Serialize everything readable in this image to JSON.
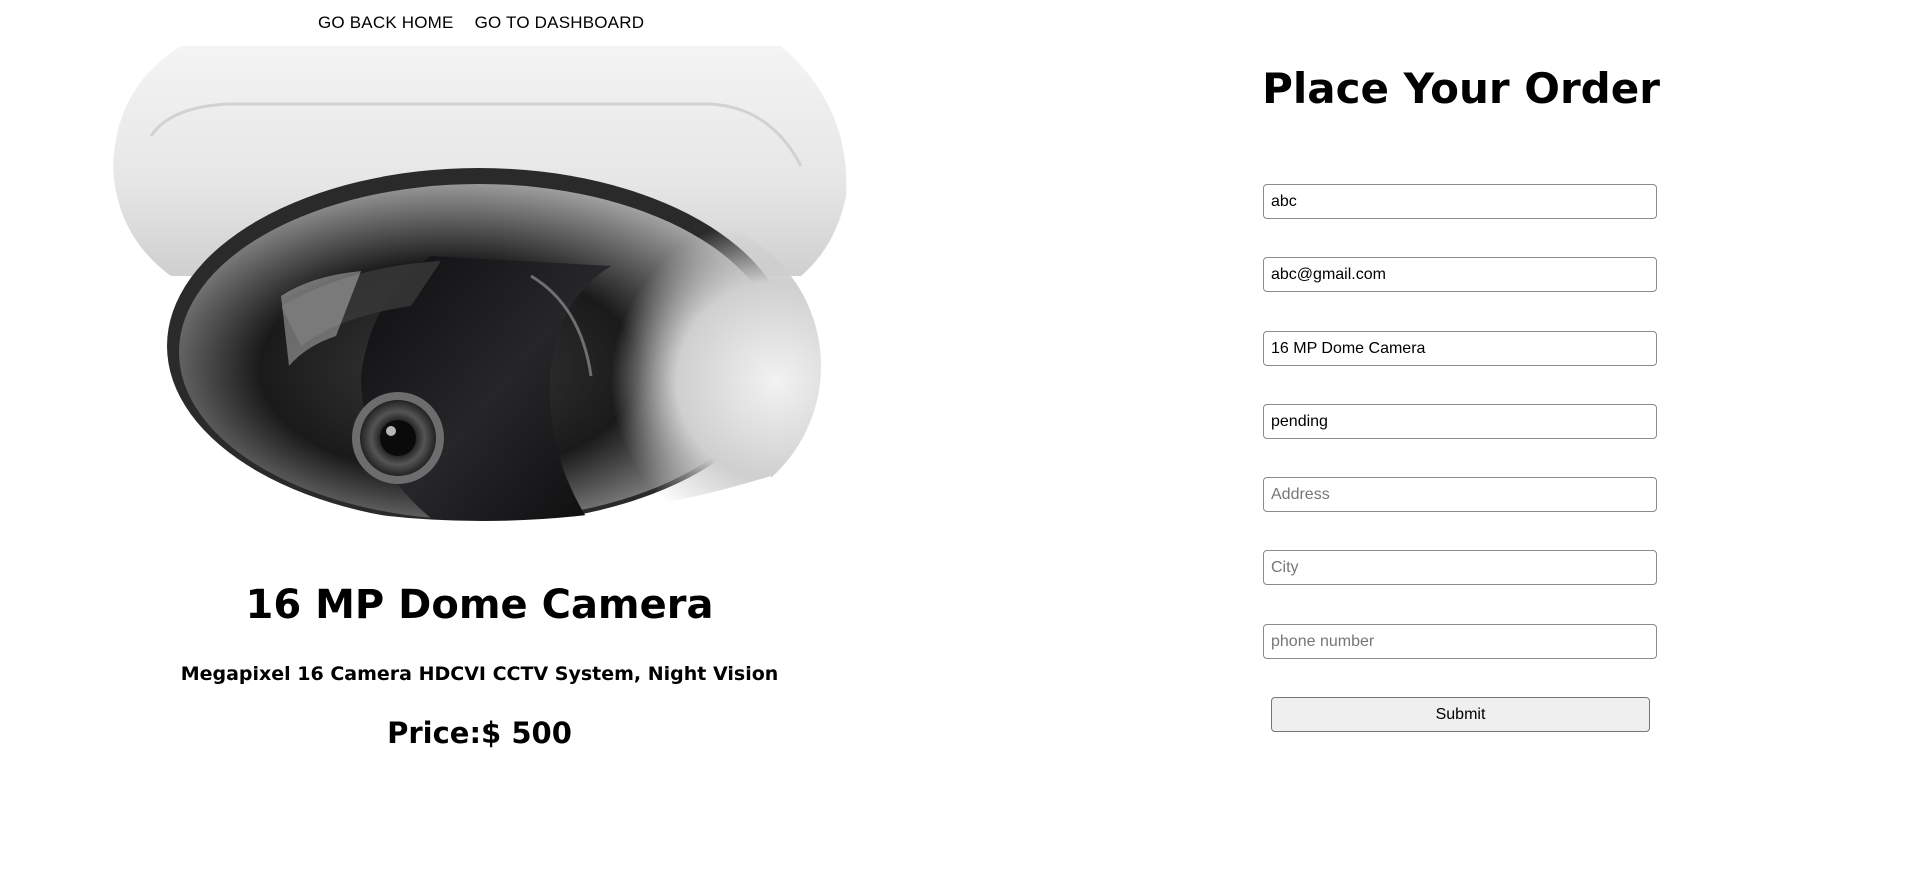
{
  "nav": {
    "home_label": "GO BACK HOME",
    "dashboard_label": "GO TO DASHBOARD"
  },
  "product": {
    "image_icon": "dome-camera-image",
    "title": "16 MP Dome Camera",
    "description": "Megapixel 16 Camera HDCVI CCTV System, Night Vision",
    "price": "Price:$ 500"
  },
  "order_form": {
    "heading": "Place Your Order",
    "name": {
      "value": "abc",
      "placeholder": ""
    },
    "email": {
      "value": "abc@gmail.com",
      "placeholder": ""
    },
    "product": {
      "value": "16 MP Dome Camera",
      "placeholder": ""
    },
    "status": {
      "value": "pending",
      "placeholder": ""
    },
    "address": {
      "value": "",
      "placeholder": "Address"
    },
    "city": {
      "value": "",
      "placeholder": "City"
    },
    "phone": {
      "value": "",
      "placeholder": "phone number"
    },
    "submit_label": "Submit"
  }
}
